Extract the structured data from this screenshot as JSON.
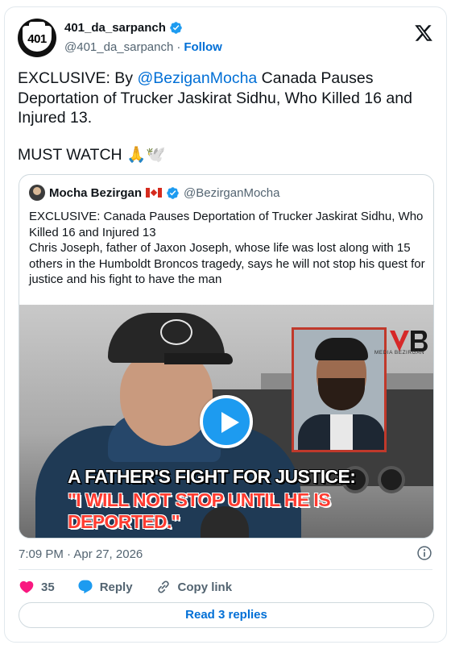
{
  "author": {
    "display_name": "401_da_sarpanch",
    "handle": "@401_da_sarpanch",
    "separator": "·",
    "follow_label": "Follow",
    "avatar_text": "401"
  },
  "tweet": {
    "text_prefix": "EXCLUSIVE: By ",
    "mention": "@BeziganMocha",
    "text_suffix": " Canada Pauses Deportation of Trucker Jaskirat Sidhu, Who Killed 16 and Injured 13.",
    "text_2": "MUST WATCH 🙏🕊️"
  },
  "quoted": {
    "display_name": "Mocha Bezirgan",
    "flag": "canada-flag",
    "handle": "@BezirganMocha",
    "text": "EXCLUSIVE: Canada Pauses Deportation of Trucker Jaskirat Sidhu, Who Killed 16 and Injured 13\nChris Joseph, father of Jaxon Joseph, whose life was lost along with 15 others in the Humboldt Broncos tragedy, says he will not stop his quest for justice and his fight to have the man",
    "media": {
      "caption_line_1": "A FATHER'S FIGHT FOR JUSTICE:",
      "caption_line_2": "\"I WILL NOT STOP UNTIL HE IS DEPORTED.\"",
      "watermark": "MEDIA BEZIRGAN",
      "play_icon": "play-icon"
    }
  },
  "meta": {
    "timestamp": "7:09 PM · Apr 27, 2026"
  },
  "actions": {
    "likes": "35",
    "reply_label": "Reply",
    "copy_link_label": "Copy link"
  },
  "read_replies_label": "Read 3 replies",
  "colors": {
    "accent": "#1d9bf0",
    "link": "#006fd6",
    "heart": "#f91880",
    "secondary_text": "#536471"
  }
}
